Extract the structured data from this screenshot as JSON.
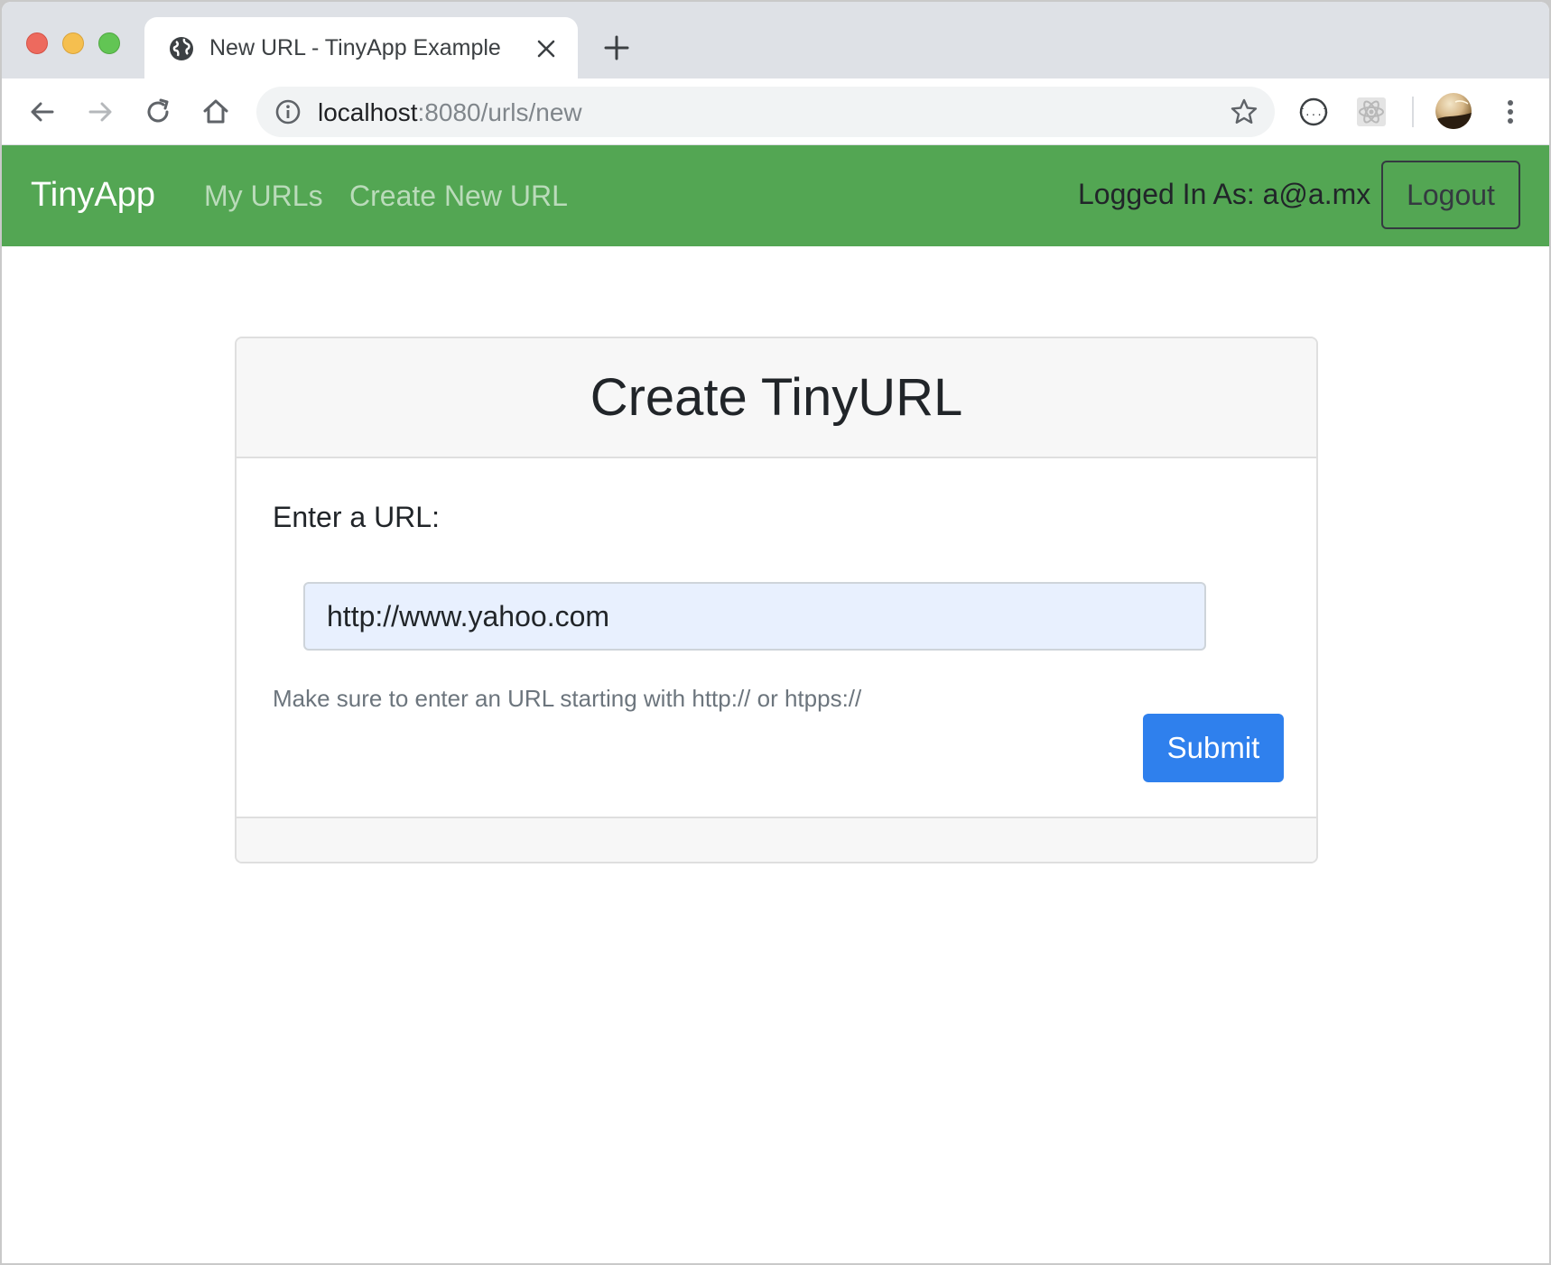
{
  "browser": {
    "tab": {
      "title": "New URL - TinyApp Example",
      "favicon": "globe-icon"
    },
    "address": {
      "host": "localhost",
      "rest": ":8080/urls/new"
    },
    "icons": [
      "back-arrow-icon",
      "forward-arrow-icon",
      "reload-icon",
      "home-icon",
      "info-icon",
      "star-icon",
      "json-extension-icon",
      "react-extension-icon",
      "profile-avatar",
      "menu-dots-icon"
    ]
  },
  "navbar": {
    "brand": "TinyApp",
    "links": [
      "My URLs",
      "Create New URL"
    ],
    "logged_in": "Logged In As: a@a.mx",
    "logout_label": "Logout",
    "background": "#53a653"
  },
  "card": {
    "title": "Create TinyURL",
    "label": "Enter a URL:",
    "input_value": "http://www.yahoo.com",
    "help": "Make sure to enter an URL starting with http:// or htpps://",
    "submit_label": "Submit",
    "submit_color": "#2f80ed"
  }
}
